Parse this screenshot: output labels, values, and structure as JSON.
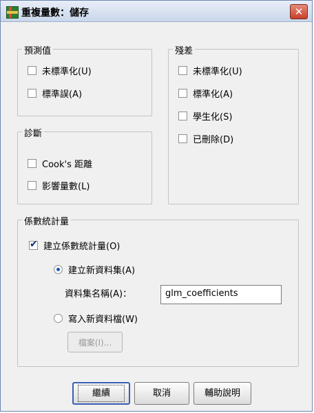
{
  "dialog": {
    "title": "重複量數：儲存",
    "close_glyph": "✕"
  },
  "predicted_values": {
    "legend": "預測值",
    "items": [
      {
        "label": "未標準化(U)",
        "checked": false
      },
      {
        "label": "標準誤(A)",
        "checked": false
      }
    ]
  },
  "residuals": {
    "legend": "殘差",
    "items": [
      {
        "label": "未標準化(U)",
        "checked": false
      },
      {
        "label": "標準化(A)",
        "checked": false
      },
      {
        "label": "學生化(S)",
        "checked": false
      },
      {
        "label": "已刪除(D)",
        "checked": false
      }
    ]
  },
  "diagnostics": {
    "legend": "診斷",
    "items": [
      {
        "label": "Cook's 距離",
        "checked": false
      },
      {
        "label": "影響量數(L)",
        "checked": false
      }
    ]
  },
  "coefficient_statistics": {
    "legend": "係數統計量",
    "create_label": "建立係數統計量(O)",
    "create_checked": true,
    "new_dataset_label": "建立新資料集(A)",
    "new_dataset_selected": true,
    "dataset_name_label": "資料集名稱(A)：",
    "dataset_name_value": "glm_coefficients",
    "write_file_label": "寫入新資料檔(W)",
    "write_file_selected": false,
    "files_button_label": "檔案(I)..."
  },
  "buttons": {
    "continue": "繼續",
    "cancel": "取消",
    "help": "輔助說明"
  }
}
